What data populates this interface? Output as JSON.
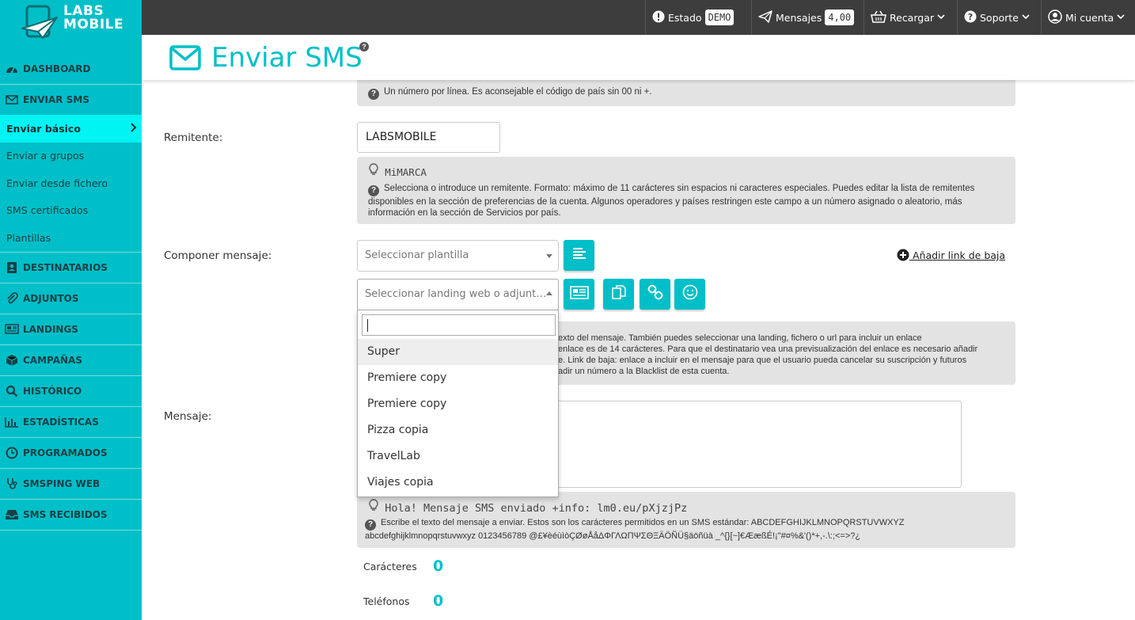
{
  "logo": {
    "line1": "LABS",
    "line2": "MOBILE"
  },
  "sidebar": {
    "items": [
      {
        "label": "DASHBOARD",
        "icon": "dashboard-icon"
      },
      {
        "label": "ENVIAR SMS",
        "icon": "envelope-icon"
      },
      {
        "label": "DESTINATARIOS",
        "icon": "contacts-icon"
      },
      {
        "label": "ADJUNTOS",
        "icon": "paperclip-icon"
      },
      {
        "label": "LANDINGS",
        "icon": "newspaper-icon"
      },
      {
        "label": "CAMPAÑAS",
        "icon": "cube-icon"
      },
      {
        "label": "HISTÓRICO",
        "icon": "search-icon"
      },
      {
        "label": "ESTADÍSTICAS",
        "icon": "bar-chart-icon"
      },
      {
        "label": "PROGRAMADOS",
        "icon": "clock-icon"
      },
      {
        "label": "SMSPING WEB",
        "icon": "stethoscope-icon"
      },
      {
        "label": "SMS RECIBIDOS",
        "icon": "inbox-icon"
      }
    ],
    "sub_items": [
      {
        "label": "Enviar básico"
      },
      {
        "label": "Enviar a grupos"
      },
      {
        "label": "Enviar desde fichero"
      },
      {
        "label": "SMS certificados"
      },
      {
        "label": "Plantillas"
      }
    ]
  },
  "topbar": {
    "estado_label": "Estado",
    "estado_badge": "DEMO",
    "mensajes_label": "Mensajes",
    "mensajes_badge": "4,00",
    "recargar_label": "Recargar",
    "soporte_label": "Soporte",
    "cuenta_label": "Mi cuenta"
  },
  "header": {
    "title": "Enviar SMS",
    "help": "?"
  },
  "form": {
    "phones_hint": "Un número por línea. Es aconsejable el código de país sin 00 ni +.",
    "remitente_label": "Remitente:",
    "remitente_value": "LABSMOBILE",
    "remitente_example": "MiMARCA",
    "remitente_hint": "Selecciona o introduce un remitente. Formato: máximo de 11 carácteres sin espacios ni caracteres especiales. Puedes editar la lista de remitentes disponibles en la sección de preferencias de la cuenta. Algunos operadores y países restringen este campo a un número asignado o aleatorio, más información en la sección de Servicios por país.",
    "componer_label": "Componer mensaje:",
    "plantilla_placeholder": "Seleccionar plantilla",
    "landing_placeholder": "Seleccionar landing web o adjunt…",
    "baja_link": "Añadir link de baja",
    "compose_hint_lines": [
      "exto del mensaje. También puedes seleccionar una landing, fichero o url para incluir un enlace",
      "enlace es de 14 carácteres. Para que el destinatario vea una previsualización del enlace es necesario añadir",
      "e. Link de baja: enlace a incluir en el mensaje para que el usuario pueda cancelar su suscripción y futuros",
      "adir un número a la Blacklist de esta cuenta."
    ],
    "mensaje_label": "Mensaje:",
    "mensaje_example": "Hola! Mensaje SMS enviado +info: lm0.eu/pXjzjPz",
    "mensaje_hint": "Escribe el texto del mensaje a enviar. Estos son los carácteres permitidos en un SMS estándar: ABCDEFGHIJKLMNOPQRSTUVWXYZ abcdefghijklmnopqrstuvwxyz 0123456789 @£¥èéùìòÇØøÅåΔΦΓΛΩΠΨΣΘΞÄÖÑÜ§äöñüà _^{}[~]€ÆæßÉ!¡\"#¤%&'()*+,-.\\:;<=>?¿",
    "caracteres_label": "Carácteres",
    "caracteres_value": "0",
    "telefonos_label": "Teléfonos",
    "telefonos_value": "0"
  },
  "dropdown": {
    "search_value": "",
    "options": [
      {
        "label": "Super"
      },
      {
        "label": "Premiere copy"
      },
      {
        "label": "Premiere copy"
      },
      {
        "label": "Pizza copia"
      },
      {
        "label": "TravelLab"
      },
      {
        "label": "Viajes copia"
      }
    ]
  },
  "colors": {
    "accent": "#00bfc8",
    "active_sub": "#00f4f4",
    "topbar": "#3d3d3d"
  }
}
